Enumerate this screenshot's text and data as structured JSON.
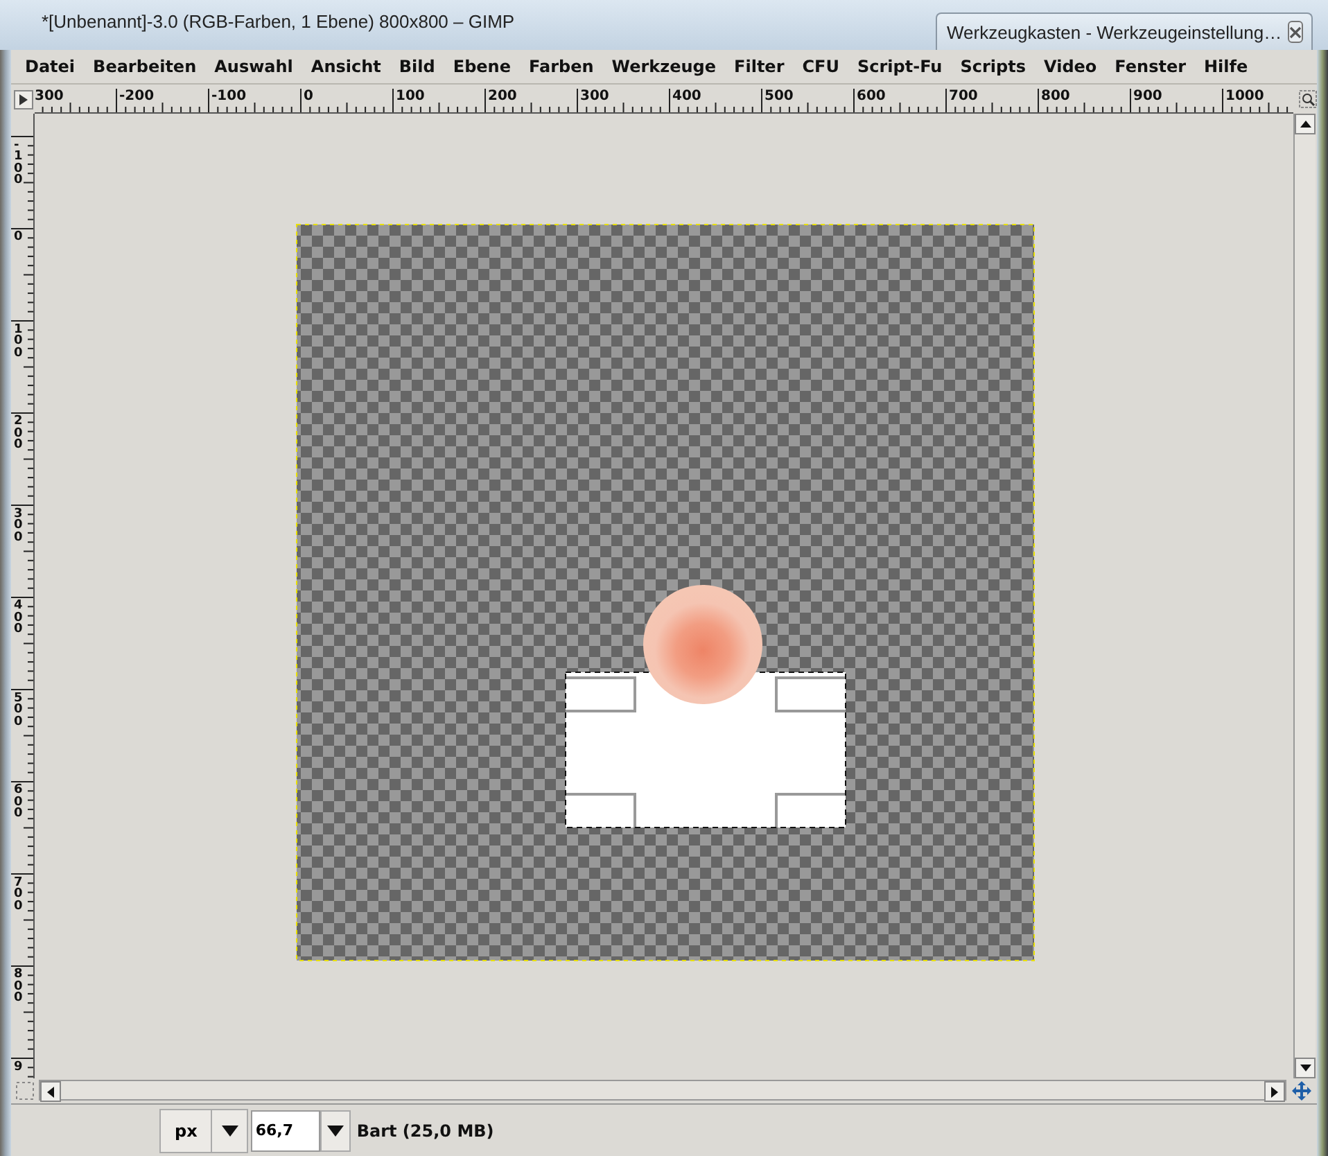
{
  "window": {
    "title": "*[Unbenannt]-3.0 (RGB-Farben, 1 Ebene) 800x800 – GIMP"
  },
  "overlapping_window": {
    "title": "Werkzeugkasten - Werkzeugeinstellung…"
  },
  "menu": [
    "Datei",
    "Bearbeiten",
    "Auswahl",
    "Ansicht",
    "Bild",
    "Ebene",
    "Farben",
    "Werkzeuge",
    "Filter",
    "CFU",
    "Script-Fu",
    "Scripts",
    "Video",
    "Fenster",
    "Hilfe"
  ],
  "ruler_horizontal": {
    "labels": [
      "300",
      "-200",
      "-100",
      "0",
      "100",
      "200",
      "300",
      "400",
      "500",
      "600",
      "700",
      "800",
      "900",
      "1000"
    ]
  },
  "ruler_vertical": {
    "labels": [
      "-100",
      "0",
      "100",
      "200",
      "300",
      "400",
      "500",
      "600",
      "700",
      "800",
      "9"
    ]
  },
  "status_bar": {
    "unit": "px",
    "zoom": "66,7",
    "message": "Bart (25,0 MB)"
  }
}
